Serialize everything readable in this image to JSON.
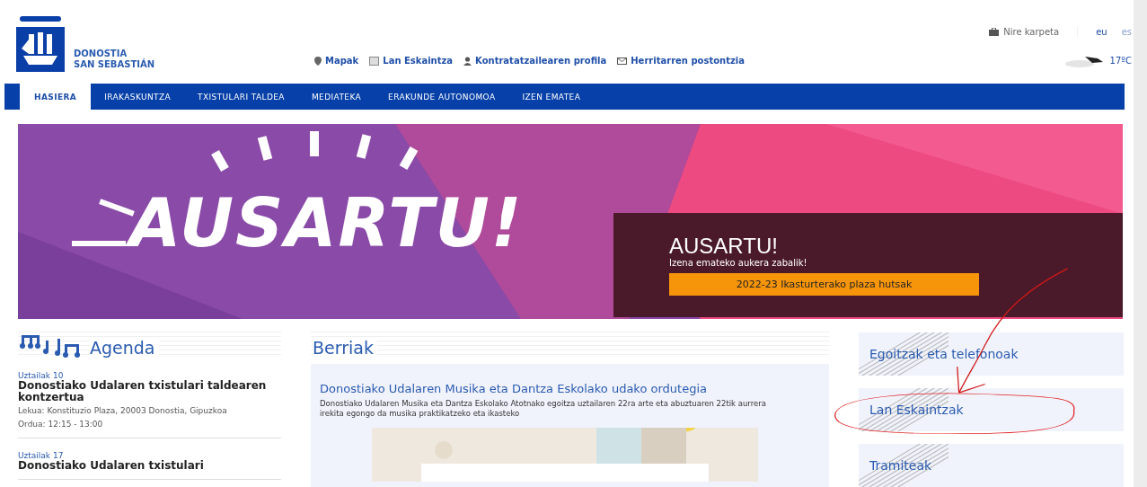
{
  "logo": {
    "line1": "DONOSTIA",
    "line2": "SAN SEBASTIÁN"
  },
  "top_links": [
    {
      "kind": "map",
      "label": "Mapak"
    },
    {
      "kind": "jobs",
      "label": "Lan Eskaintza"
    },
    {
      "kind": "profile",
      "label": "Kontratatzailearen profila"
    },
    {
      "kind": "mail",
      "label": "Herritarren postontzia"
    }
  ],
  "account": {
    "label": "Nire karpeta"
  },
  "languages": [
    {
      "label": "eu",
      "selected": true
    },
    {
      "label": "es",
      "selected": false
    }
  ],
  "weather": {
    "temperature": "17ºC"
  },
  "nav": [
    {
      "label": "HASIERA",
      "selected": true
    },
    {
      "label": "IRAKASKUNTZA",
      "selected": false
    },
    {
      "label": "TXISTULARI TALDEA",
      "selected": false
    },
    {
      "label": "MEDIATEKA",
      "selected": false
    },
    {
      "label": "ERAKUNDE AUTONOMOA",
      "selected": false
    },
    {
      "label": "IZEN EMATEA",
      "selected": false
    }
  ],
  "banner": {
    "headline": "AUSARTU!",
    "title": "AUSARTU!",
    "subtitle": "Izena emateko aukera zabalik!",
    "button": "2022-23 Ikasturterako plaza hutsak"
  },
  "agenda": {
    "title": "Agenda",
    "events": [
      {
        "date": "Uztailak 10",
        "title": "Donostiako Udalaren txistulari taldearen kontzertua",
        "place": "Lekua: Konstituzio Plaza, 20003 Donostia, Gipuzkoa",
        "time": "Ordua: 12:15 - 13:00"
      },
      {
        "date": "Uztailak 17",
        "title": "Donostiako Udalaren txistulari"
      }
    ]
  },
  "news": {
    "title": "Berriak",
    "items": [
      {
        "title": "Donostiako Udalaren Musika eta Dantza Eskolako udako ordutegia",
        "text": "Donostiako Udalaren Musika eta Dantza Eskolako Atotnako egoitza uztailaren 22ra arte eta abuztuaren 22tik aurrera irekita egongo da musika praktikatzeko eta ikasteko",
        "kind": "picture"
      }
    ]
  },
  "quick_links": [
    {
      "label": "Egoitzak eta telefonoak",
      "highlighted": false
    },
    {
      "label": "Lan Eskaintzak",
      "highlighted": true
    },
    {
      "label": "Tramiteak",
      "highlighted": false
    }
  ]
}
